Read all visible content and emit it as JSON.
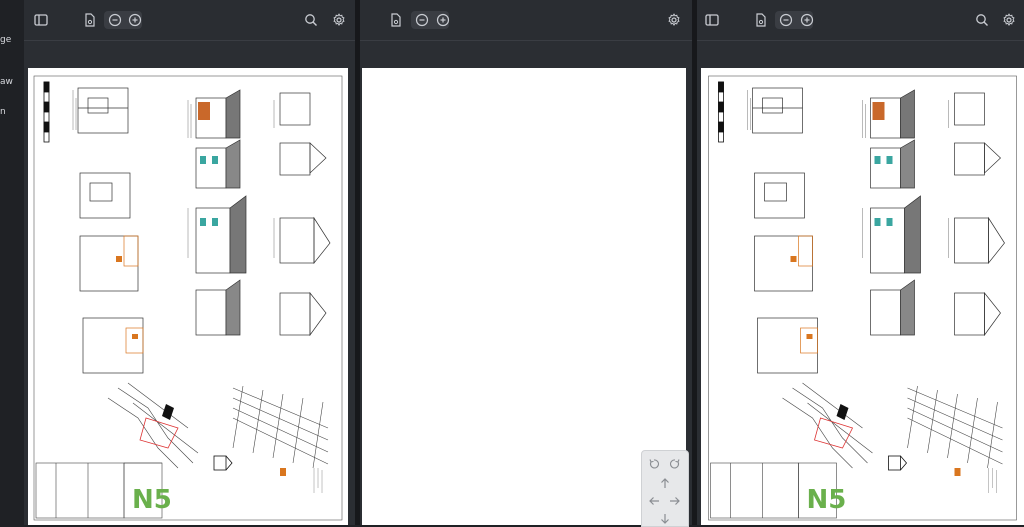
{
  "left_strip": {
    "fragments": [
      "ge",
      "aw",
      "n"
    ]
  },
  "panes": [
    {
      "id": "left",
      "toolbar": {
        "sidebar_toggle": "sidebar-icon",
        "page_icon": "document-icon",
        "zoom_out": "minus-circle-icon",
        "zoom_in": "plus-circle-icon",
        "search": "search-icon",
        "settings": "gear-icon"
      }
    },
    {
      "id": "middle",
      "toolbar": {
        "page_icon": "document-icon",
        "zoom_out": "minus-circle-icon",
        "zoom_in": "plus-circle-icon",
        "settings": "gear-icon"
      }
    },
    {
      "id": "right",
      "toolbar": {
        "sidebar_toggle": "sidebar-icon",
        "page_icon": "document-icon",
        "zoom_out": "minus-circle-icon",
        "zoom_in": "plus-circle-icon",
        "search": "search-icon",
        "settings": "gear-icon"
      }
    }
  ],
  "nav_pad": {
    "rotate_ccw": "rotate-ccw-icon",
    "rotate_cw": "rotate-cw-icon",
    "up": "arrow-up-icon",
    "left": "arrow-left-icon",
    "right": "arrow-right-icon",
    "down": "arrow-down-icon"
  },
  "colors": {
    "toolbar": "#2a2d32",
    "stage": "#2b2e33",
    "sheet": "#ffffff",
    "accent_orange": "#d9761f",
    "logo_green": "#6ab04c",
    "facade_teal": "#3aa6a0"
  }
}
